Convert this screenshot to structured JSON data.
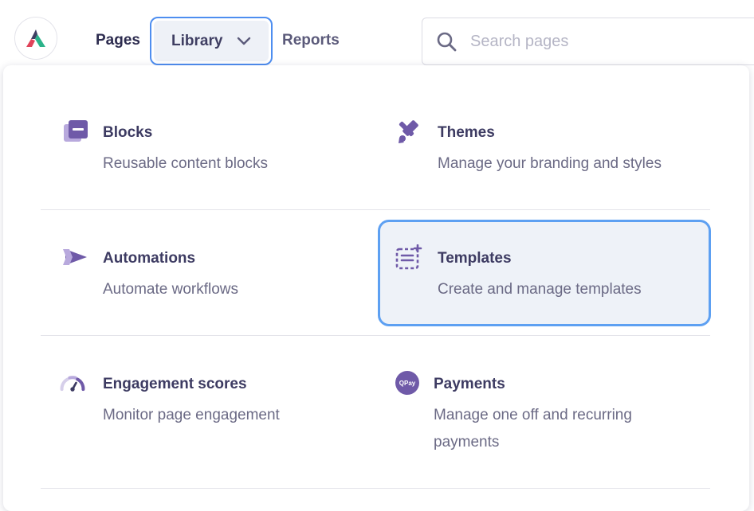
{
  "header": {
    "nav": {
      "pages_label": "Pages",
      "library_label": "Library",
      "reports_label": "Reports"
    },
    "search": {
      "placeholder": "Search pages"
    }
  },
  "library_menu": {
    "items": [
      {
        "title": "Blocks",
        "description": "Reusable content blocks",
        "icon": "blocks-icon"
      },
      {
        "title": "Themes",
        "description": "Manage your branding and styles",
        "icon": "paintbrush-icon"
      },
      {
        "title": "Automations",
        "description": "Automate workflows",
        "icon": "automation-arrow-icon"
      },
      {
        "title": "Templates",
        "description": "Create and manage templates",
        "icon": "template-icon",
        "selected": true
      },
      {
        "title": "Engagement scores",
        "description": "Monitor page engagement",
        "icon": "gauge-icon"
      },
      {
        "title": "Payments",
        "description_line1": "Manage one off and recurring",
        "description_line2": "payments",
        "icon": "qpay-icon",
        "icon_text": "QPay"
      }
    ]
  },
  "colors": {
    "accent_blue": "#4e8ef0",
    "icon_purple": "#6f5aa8",
    "selected_bg": "#eef2f8"
  }
}
